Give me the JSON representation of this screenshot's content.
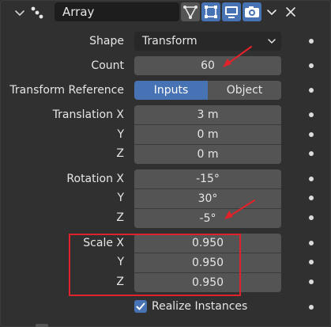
{
  "header": {
    "modifier_name": "Array",
    "icons": [
      "collapse-chevron-icon",
      "geometry-nodes-icon",
      "vertex-triangle-icon",
      "edit-mode-icon",
      "realtime-display-icon",
      "render-camera-icon",
      "dropdown-chevron-icon",
      "close-icon"
    ]
  },
  "fields": {
    "shape": {
      "label": "Shape",
      "value": "Transform"
    },
    "count": {
      "label": "Count",
      "value": "60"
    },
    "transform_reference": {
      "label": "Transform Reference",
      "options": [
        "Inputs",
        "Object"
      ],
      "selected": "Inputs"
    },
    "translation": {
      "label_x": "Translation X",
      "label_y": "Y",
      "label_z": "Z",
      "x": "3 m",
      "y": "0 m",
      "z": "0 m"
    },
    "rotation": {
      "label_x": "Rotation X",
      "label_y": "Y",
      "label_z": "Z",
      "x": "-15°",
      "y": "30°",
      "z": "-5°"
    },
    "scale": {
      "label_x": "Scale X",
      "label_y": "Y",
      "label_z": "Z",
      "x": "0.950",
      "y": "0.950",
      "z": "0.950"
    },
    "realize_instances": {
      "label": "Realize Instances",
      "checked": true
    }
  },
  "colors": {
    "panel_bg": "#303030",
    "field_bg": "#545454",
    "accent_blue": "#4772b3",
    "annotation_red": "#e0222a"
  }
}
